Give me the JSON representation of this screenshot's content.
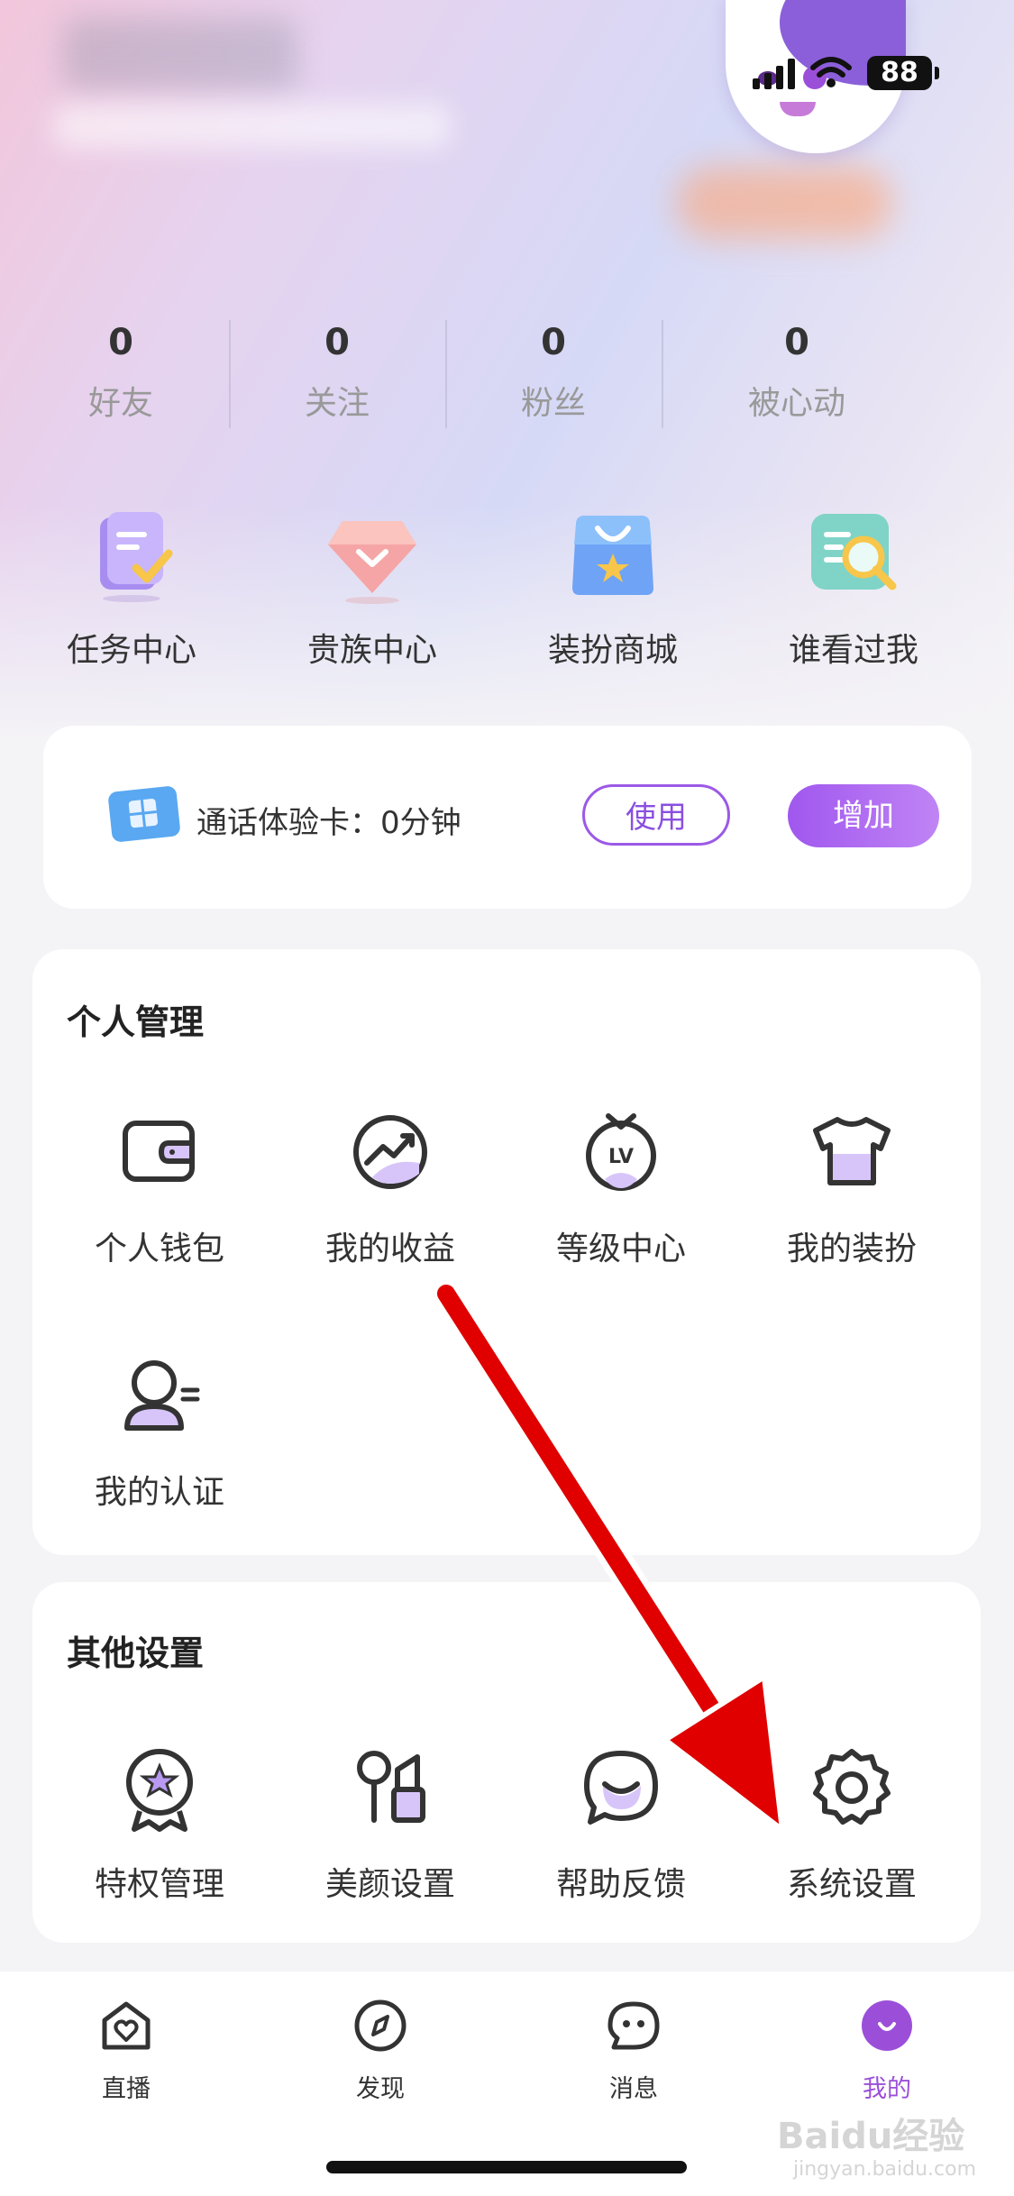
{
  "status_bar": {
    "battery": "88"
  },
  "stats": [
    {
      "value": "0",
      "label": "好友"
    },
    {
      "value": "0",
      "label": "关注"
    },
    {
      "value": "0",
      "label": "粉丝"
    },
    {
      "value": "0",
      "label": "被心动"
    }
  ],
  "quick_actions": [
    {
      "label": "任务中心",
      "icon": "task-clipboard-icon"
    },
    {
      "label": "贵族中心",
      "icon": "diamond-icon"
    },
    {
      "label": "装扮商城",
      "icon": "shopping-bag-icon"
    },
    {
      "label": "谁看过我",
      "icon": "magnifier-icon"
    }
  ],
  "call_card": {
    "text": "通话体验卡：0分钟",
    "use_label": "使用",
    "add_label": "增加"
  },
  "personal_management": {
    "title": "个人管理",
    "items": [
      {
        "label": "个人钱包",
        "icon": "wallet-icon"
      },
      {
        "label": "我的收益",
        "icon": "earnings-chart-icon"
      },
      {
        "label": "等级中心",
        "icon": "level-badge-icon"
      },
      {
        "label": "我的装扮",
        "icon": "tshirt-icon"
      },
      {
        "label": "我的认证",
        "icon": "verify-user-icon"
      }
    ]
  },
  "other_settings": {
    "title": "其他设置",
    "items": [
      {
        "label": "特权管理",
        "icon": "privilege-medal-icon"
      },
      {
        "label": "美颜设置",
        "icon": "beauty-makeup-icon"
      },
      {
        "label": "帮助反馈",
        "icon": "help-chat-icon"
      },
      {
        "label": "系统设置",
        "icon": "gear-icon"
      }
    ]
  },
  "tabbar": [
    {
      "label": "直播",
      "icon": "live-house-icon",
      "active": false
    },
    {
      "label": "发现",
      "icon": "compass-icon",
      "active": false
    },
    {
      "label": "消息",
      "icon": "message-bubble-icon",
      "active": false
    },
    {
      "label": "我的",
      "icon": "profile-smile-icon",
      "active": true
    }
  ],
  "colors": {
    "accent": "#9b4fd9",
    "annotation_arrow": "#e00000"
  },
  "watermark": {
    "brand": "Baidu经验",
    "url": "jingyan.baidu.com"
  }
}
